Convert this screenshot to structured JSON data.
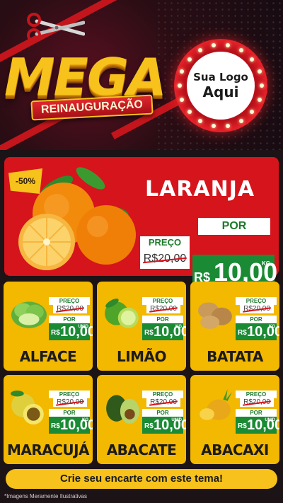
{
  "header": {
    "title": "MEGA",
    "subtitle": "REINAUGURAÇÃO",
    "logo_line1": "Sua Logo",
    "logo_line2": "Aqui"
  },
  "hero": {
    "name": "LARANJA",
    "discount": "-50%",
    "preco_label": "PREÇO",
    "old_price": "R$20,00",
    "por_label": "POR",
    "currency": "R$",
    "new_price": "10,00",
    "unit": "KG"
  },
  "products": [
    {
      "name": "ALFACE",
      "preco_label": "PREÇO",
      "old_price": "R$20,00",
      "por_label": "POR",
      "currency": "R$",
      "new_price": "10,00",
      "unit": "UNID"
    },
    {
      "name": "LIMÃO",
      "preco_label": "PREÇO",
      "old_price": "R$20,00",
      "por_label": "POR",
      "currency": "R$",
      "new_price": "10,00",
      "unit": "KG"
    },
    {
      "name": "BATATA",
      "preco_label": "PREÇO",
      "old_price": "R$20,00",
      "por_label": "POR",
      "currency": "R$",
      "new_price": "10,00",
      "unit": "KG"
    },
    {
      "name": "MARACUJÁ",
      "preco_label": "PREÇO",
      "old_price": "R$20,00",
      "por_label": "POR",
      "currency": "R$",
      "new_price": "10,00",
      "unit": "KG"
    },
    {
      "name": "ABACATE",
      "preco_label": "PREÇO",
      "old_price": "R$20,00",
      "por_label": "POR",
      "currency": "R$",
      "new_price": "10,00",
      "unit": "UNID"
    },
    {
      "name": "ABACAXI",
      "preco_label": "PREÇO",
      "old_price": "R$20,00",
      "por_label": "POR",
      "currency": "R$",
      "new_price": "10,00",
      "unit": "UNID"
    }
  ],
  "cta": "Crie seu encarte com este tema!",
  "disclaimer": "*Imagens Meramente Ilustrativas",
  "colors": {
    "brand_red": "#d5141c",
    "brand_yellow": "#f3b800",
    "price_green": "#1a8a34"
  },
  "icons": [
    "scissors-icon",
    "orange-image",
    "lettuce-image",
    "lime-image",
    "potato-image",
    "passion-fruit-image",
    "avocado-image",
    "pineapple-image"
  ]
}
